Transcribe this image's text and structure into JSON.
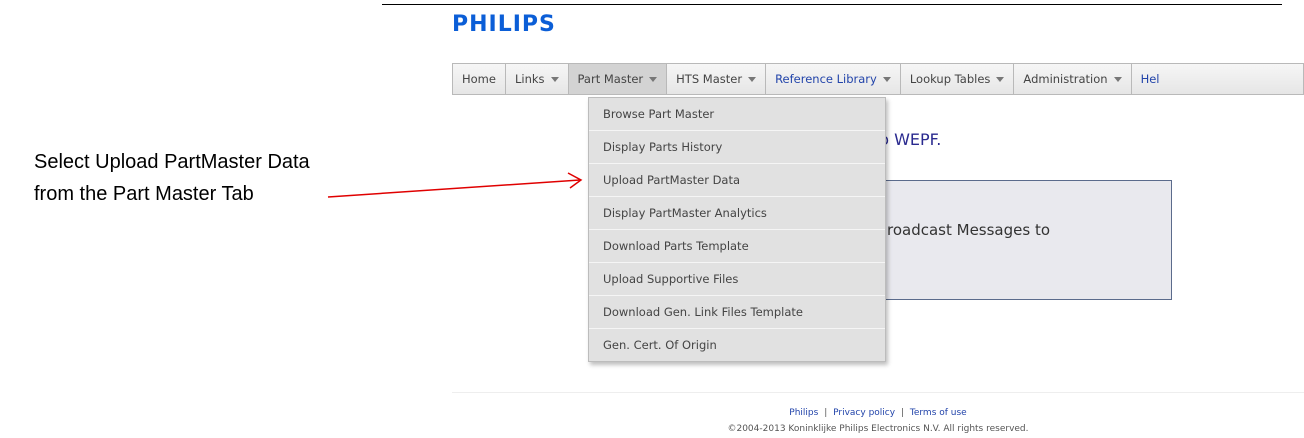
{
  "logo": "PHILIPS",
  "annotation": {
    "line1": "Select Upload PartMaster Data",
    "line2": "from the Part Master Tab",
    "arrow_color": "#e00000"
  },
  "nav": {
    "tabs": [
      {
        "label": "Home",
        "dropdown": false,
        "active": false,
        "color": "#444444"
      },
      {
        "label": "Links",
        "dropdown": true,
        "active": false,
        "color": "#444444"
      },
      {
        "label": "Part Master",
        "dropdown": true,
        "active": true,
        "color": "#444444"
      },
      {
        "label": "HTS Master",
        "dropdown": true,
        "active": false,
        "color": "#444444"
      },
      {
        "label": "Reference Library",
        "dropdown": true,
        "active": false,
        "color": "#2244aa"
      },
      {
        "label": "Lookup Tables",
        "dropdown": true,
        "active": false,
        "color": "#444444"
      },
      {
        "label": "Administration",
        "dropdown": true,
        "active": false,
        "color": "#444444"
      },
      {
        "label": "Hel",
        "dropdown": false,
        "active": false,
        "color": "#2244aa"
      }
    ]
  },
  "dropdown": {
    "items": [
      "Browse Part Master",
      "Display Parts History",
      "Upload PartMaster Data",
      "Display PartMaster Analytics",
      "Download Parts Template",
      "Upload Supportive Files",
      "Download Gen. Link Files Template",
      "Gen. Cert. Of Origin"
    ]
  },
  "main": {
    "welcome_partial": "e to WEPF.",
    "broadcast_partial": "roadcast Messages to"
  },
  "footer": {
    "links": [
      "Philips",
      "Privacy policy",
      "Terms of use"
    ],
    "separator": "|",
    "copyright": "©2004-2013 Koninklijke Philips Electronics N.V. All rights reserved."
  }
}
